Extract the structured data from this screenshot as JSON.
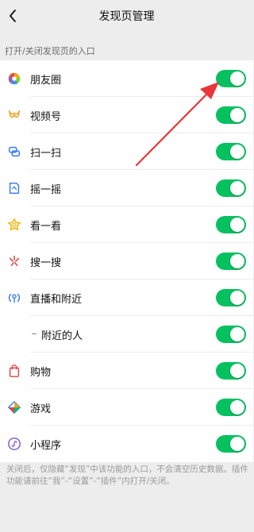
{
  "nav": {
    "title": "发现页管理"
  },
  "section": {
    "header": "打开/关闭发现页的入口"
  },
  "items": [
    {
      "label": "朋友圈",
      "icon": "moments-icon",
      "enabled": true,
      "sub": false
    },
    {
      "label": "视频号",
      "icon": "channels-icon",
      "enabled": true,
      "sub": false
    },
    {
      "label": "扫一扫",
      "icon": "scan-icon",
      "enabled": true,
      "sub": false
    },
    {
      "label": "摇一摇",
      "icon": "shake-icon",
      "enabled": true,
      "sub": false
    },
    {
      "label": "看一看",
      "icon": "top-stories-icon",
      "enabled": true,
      "sub": false
    },
    {
      "label": "搜一搜",
      "icon": "search-icon",
      "enabled": true,
      "sub": false
    },
    {
      "label": "直播和附近",
      "icon": "live-nearby-icon",
      "enabled": true,
      "sub": false
    },
    {
      "label": "附近的人",
      "icon": "",
      "enabled": true,
      "sub": true
    },
    {
      "label": "购物",
      "icon": "shopping-icon",
      "enabled": true,
      "sub": false
    },
    {
      "label": "游戏",
      "icon": "games-icon",
      "enabled": true,
      "sub": false
    },
    {
      "label": "小程序",
      "icon": "mini-programs-icon",
      "enabled": true,
      "sub": false
    }
  ],
  "footer": {
    "note": "关闭后，仅隐藏“发现”中该功能的入口，不会清空历史数据。插件功能请前往“我”-“设置”-“插件”内打开/关闭。"
  },
  "colors": {
    "toggle_on": "#07c160",
    "annotation_arrow": "#e8363a",
    "background": "#ededed"
  }
}
